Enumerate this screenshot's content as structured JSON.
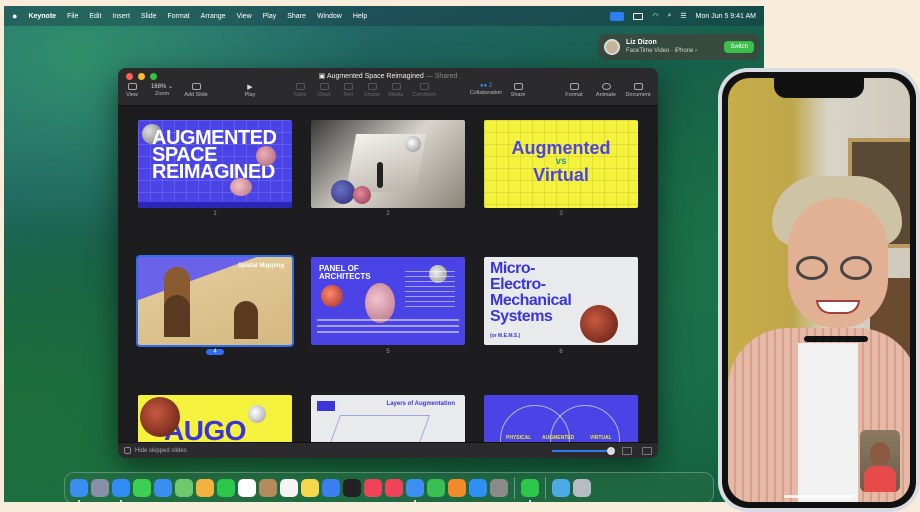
{
  "menubar": {
    "app_name": "Keynote",
    "menus": [
      "File",
      "Edit",
      "Insert",
      "Slide",
      "Format",
      "Arrange",
      "View",
      "Play",
      "Share",
      "Window",
      "Help"
    ],
    "datetime": "Mon Jun 5  9:41 AM"
  },
  "notification": {
    "name": "Liz Dizon",
    "subtitle": "FaceTime Video · iPhone ›",
    "button": "Switch"
  },
  "window": {
    "title": "Augmented Space Reimagined",
    "shared": "— Shared",
    "toolbar": {
      "view": "View",
      "zoom_value": "168% ⌄",
      "zoom": "Zoom",
      "add_slide": "Add Slide",
      "play": "Play",
      "table": "Table",
      "chart": "Chart",
      "text": "Text",
      "shape": "Shape",
      "media": "Media",
      "comment": "Comment",
      "collaboration": "Collaboration",
      "collab_count": "2",
      "share": "Share",
      "format": "Format",
      "animate": "Animate",
      "document": "Document"
    },
    "bottom": {
      "hide_skipped": "Hide skipped slides"
    }
  },
  "slides": {
    "s1": {
      "line1": "AUGMENTED",
      "line2": "SPACE",
      "line3": "REIMAGINED",
      "num": "1"
    },
    "s2": {
      "num": "2"
    },
    "s3": {
      "line1": "Augmented",
      "line2": "vs",
      "line3": "Virtual",
      "num": "3"
    },
    "s4": {
      "title": "Spatial Mapping",
      "num": "4"
    },
    "s5": {
      "title1": "PANEL OF",
      "title2": "ARCHITECTS",
      "num": "5"
    },
    "s6": {
      "line1": "Micro-",
      "line2": "Electro-",
      "line3": "Mechanical",
      "line4": "Systems",
      "sub": "(or M.E.M.S.)",
      "num": "6"
    },
    "s7": {
      "text": "AUGO"
    },
    "s8": {
      "title": "Layers of Augmentation"
    },
    "s9": {
      "label_a": "PHYSICAL",
      "label_b": "AUGMENTED",
      "label_c": "VIRTUAL"
    }
  },
  "colors": {
    "slide_blue": "#4a44e6",
    "slide_yellow": "#f4f23c",
    "accent": "#2e6ef0"
  },
  "dock": {
    "apps": [
      {
        "name": "finder",
        "color": "#3a8ef0"
      },
      {
        "name": "launchpad",
        "color": "#8a8fa8"
      },
      {
        "name": "safari",
        "color": "#2f8df5"
      },
      {
        "name": "messages",
        "color": "#3ccf52"
      },
      {
        "name": "mail",
        "color": "#3a8ef0"
      },
      {
        "name": "maps",
        "color": "#6fc86a"
      },
      {
        "name": "photos",
        "color": "#f3b23e"
      },
      {
        "name": "facetime",
        "color": "#2dc74a"
      },
      {
        "name": "calendar",
        "color": "#ffffff"
      },
      {
        "name": "contacts",
        "color": "#b58a5a"
      },
      {
        "name": "reminders",
        "color": "#f4f4f4"
      },
      {
        "name": "notes",
        "color": "#f5d64c"
      },
      {
        "name": "freeform",
        "color": "#3a7ef0"
      },
      {
        "name": "tv",
        "color": "#222222"
      },
      {
        "name": "music",
        "color": "#f0435a"
      },
      {
        "name": "news",
        "color": "#f0435a"
      },
      {
        "name": "keynote",
        "color": "#3d8ef0"
      },
      {
        "name": "numbers",
        "color": "#38c150"
      },
      {
        "name": "pages",
        "color": "#f28a2a"
      },
      {
        "name": "app-store",
        "color": "#2f8ff5"
      },
      {
        "name": "system-settings",
        "color": "#8a8a8a"
      }
    ],
    "extra": [
      {
        "name": "facetime-continuity",
        "color": "#2dc74a"
      },
      {
        "name": "downloads-folder",
        "color": "#4ea9e8"
      },
      {
        "name": "trash",
        "color": "#b7bcc0"
      }
    ]
  }
}
